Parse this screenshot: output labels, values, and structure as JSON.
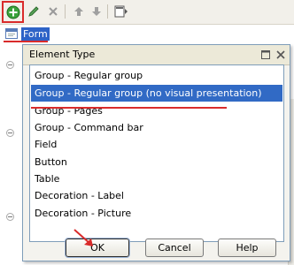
{
  "toolbar": {
    "buttons": [
      {
        "name": "add-icon",
        "color": "#2e9b2e"
      },
      {
        "name": "edit-icon",
        "color": "#3a8a3a"
      },
      {
        "name": "delete-icon",
        "color": "#8a8a8a"
      },
      {
        "name": "move-up-icon",
        "color": "#8a8a8a"
      },
      {
        "name": "move-down-icon",
        "color": "#8a8a8a"
      },
      {
        "name": "form-icon",
        "color": "#555555"
      }
    ]
  },
  "tree": {
    "root_label": "Form"
  },
  "dialog": {
    "title": "Element Type",
    "items": [
      "Group - Regular group",
      "Group - Regular group (no visual presentation)",
      "Group - Pages",
      "Group - Command bar",
      "Field",
      "Button",
      "Table",
      "Decoration - Label",
      "Decoration - Picture"
    ],
    "selected_index": 1,
    "buttons": {
      "ok": "OK",
      "cancel": "Cancel",
      "help": "Help"
    }
  },
  "colors": {
    "selection": "#316ac5",
    "highlight_annotation": "#d92b2b",
    "dialog_bg": "#f4f3ee"
  }
}
